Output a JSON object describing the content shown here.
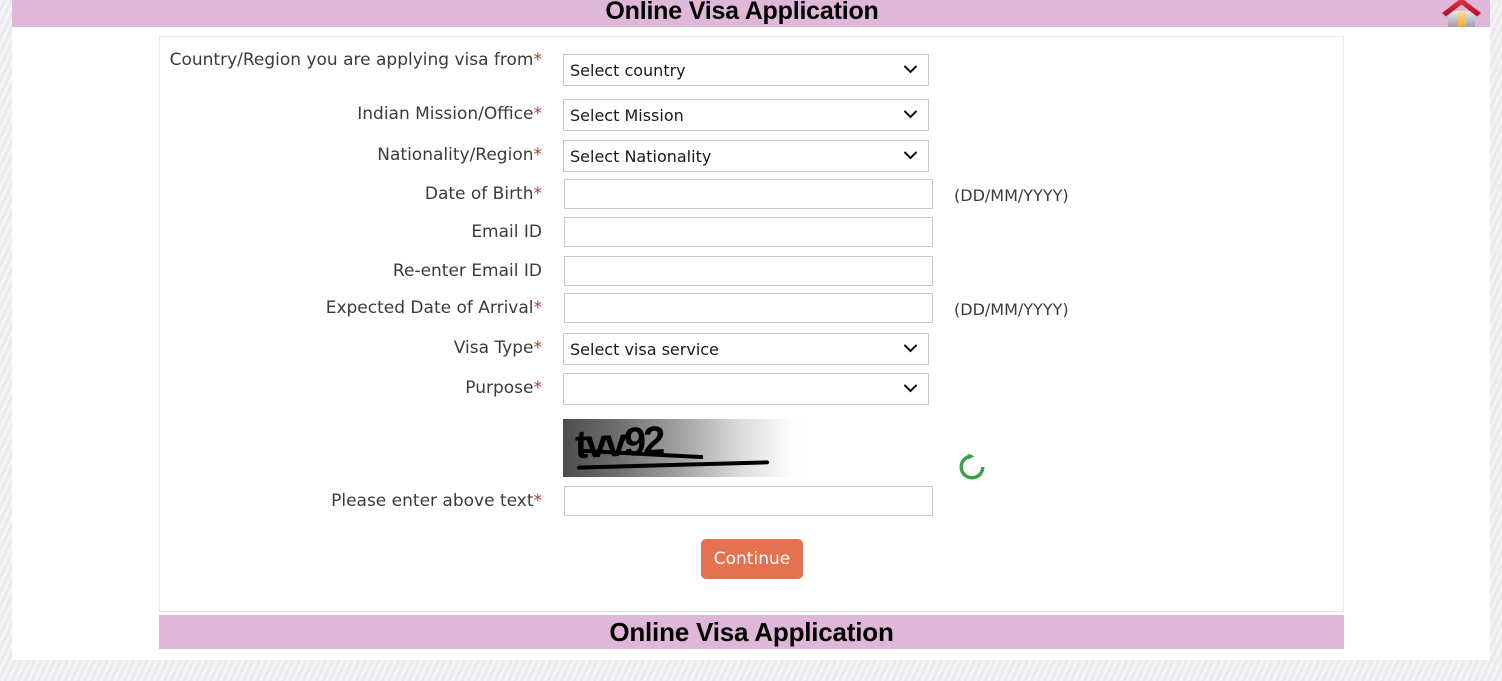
{
  "header": {
    "title": "Online Visa Application",
    "home_icon": "home-icon"
  },
  "footer": {
    "title": "Online Visa Application"
  },
  "form": {
    "fields": [
      {
        "label": "Country/Region you are applying visa from",
        "required": true,
        "control": "select",
        "value": "Select country",
        "hint": ""
      },
      {
        "label": "Indian Mission/Office",
        "required": true,
        "control": "select",
        "value": "Select Mission",
        "hint": ""
      },
      {
        "label": "Nationality/Region",
        "required": true,
        "control": "select",
        "value": "Select Nationality",
        "hint": ""
      },
      {
        "label": "Date of Birth",
        "required": true,
        "control": "text",
        "value": "",
        "placeholder": "",
        "hint": "(DD/MM/YYYY)"
      },
      {
        "label": "Email ID",
        "required": false,
        "control": "text",
        "value": "",
        "placeholder": "",
        "hint": ""
      },
      {
        "label": "Re-enter Email ID",
        "required": false,
        "control": "text",
        "value": "",
        "placeholder": "",
        "hint": ""
      },
      {
        "label": "Expected Date of Arrival",
        "required": true,
        "control": "text",
        "value": "",
        "placeholder": "",
        "hint": "(DD/MM/YYYY)"
      },
      {
        "label": "Visa Type",
        "required": true,
        "control": "select",
        "value": "Select visa service",
        "hint": ""
      },
      {
        "label": "Purpose",
        "required": true,
        "control": "select",
        "value": "",
        "hint": ""
      },
      {
        "label": "Please enter above text",
        "required": true,
        "control": "text",
        "value": "",
        "placeholder": "",
        "hint": ""
      }
    ],
    "captcha": {
      "text": "tvv92",
      "refresh_icon": "refresh-icon"
    },
    "submit_label": "Continue",
    "required_marker": "*"
  },
  "colors": {
    "banner": "#dfb8d9",
    "submit_button": "#e4714f",
    "required_star": "#b13a3a",
    "refresh_icon": "#3aa14a",
    "home_roof": "#cf1028"
  }
}
